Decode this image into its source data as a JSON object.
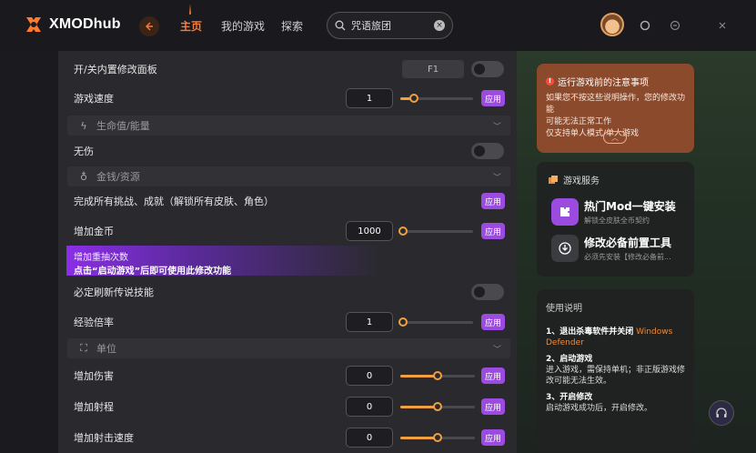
{
  "topbar": {
    "logo_text": "XMODhub",
    "nav": [
      "主页",
      "我的游戏",
      "探索"
    ],
    "active_nav": 0,
    "search_value": "咒语旅团",
    "accent_color": "#ff7a2f"
  },
  "mods": {
    "panel_toggle_label": "开/关内置修改面板",
    "panel_hotkey": "F1",
    "game_speed_label": "游戏速度",
    "game_speed_value": "1",
    "section_health": "生命值/能量",
    "invincible_label": "无伤",
    "section_money": "金钱/资源",
    "unlock_all_label": "完成所有挑战、成就（解锁所有皮肤、角色）",
    "add_gold_label": "增加金币",
    "add_gold_value": "1000",
    "add_draws_label": "增加重抽次数",
    "add_draws_notice": "点击“启动游戏”后即可使用此修改功能",
    "legend_refresh_label": "必定刷新传说技能",
    "exp_rate_label": "经验倍率",
    "exp_rate_value": "1",
    "section_unit": "单位",
    "add_damage_label": "增加伤害",
    "add_damage_value": "0",
    "add_range_label": "增加射程",
    "add_range_value": "0",
    "add_fire_rate_label": "增加射击速度",
    "add_fire_rate_value": "0",
    "apply_label": "应用",
    "apply_color": "#9b4be0"
  },
  "sidebar": {
    "warning_title": "运行游戏前的注意事项",
    "warning_lines": [
      "如果您不按这些说明操作，您的修改功能",
      "可能无法正常工作",
      "仅支持单人模式/单人游戏"
    ],
    "services_title": "游戏服务",
    "services": [
      {
        "name": "热门Mod一键安装",
        "sub": "解锁全皮肤全币契约",
        "icon": "puzzle-icon"
      },
      {
        "name": "修改必备前置工具",
        "sub": "必须先安装【修改必备前..."
      }
    ],
    "help_title": "使用说明",
    "help_steps": [
      {
        "title": "1、退出杀毒软件并关闭",
        "highlight": "Windows Defender",
        "body": ""
      },
      {
        "title": "2、启动游戏",
        "highlight": "",
        "body": "进入游戏，需保持单机；非正版游戏修改可能无法生效。"
      },
      {
        "title": "3、开启修改",
        "highlight": "",
        "body": "启动游戏成功后，开启修改。"
      }
    ]
  }
}
